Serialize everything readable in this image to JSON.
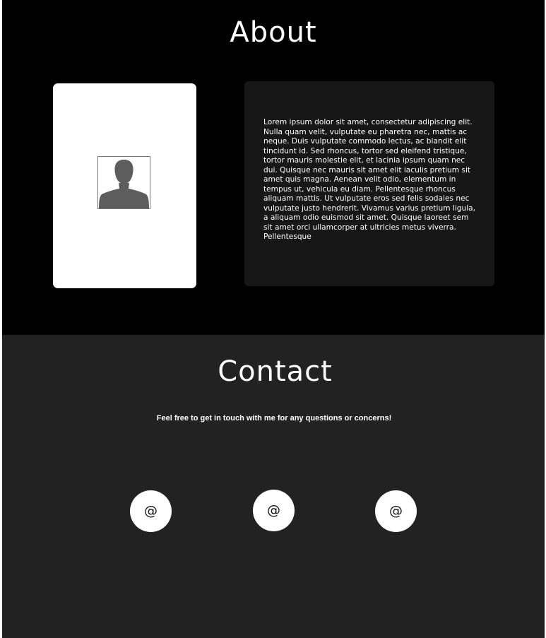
{
  "about": {
    "title": "About",
    "bio": "Lorem ipsum dolor sit amet, consectetur adipiscing elit. Nulla quam velit, vulputate eu pharetra nec, mattis ac neque. Duis vulputate commodo lectus, ac blandit elit tincidunt id. Sed rhoncus, tortor sed eleifend tristique, tortor mauris molestie elit, et lacinia ipsum quam nec dui. Quisque nec mauris sit amet elit iaculis pretium sit amet quis magna. Aenean velit odio, elementum in tempus ut, vehicula eu diam. Pellentesque rhoncus aliquam mattis. Ut vulputate eros sed felis sodales nec vulputate justo hendrerit. Vivamus varius pretium ligula, a aliquam odio euismod sit amet. Quisque laoreet sem sit amet orci ullamcorper at ultricies metus viverra. Pellentesque",
    "avatar_icon": "user-silhouette-icon"
  },
  "contact": {
    "title": "Contact",
    "note": "Feel free to get in touch with me for any questions or concerns!",
    "buttons": [
      {
        "label": "@",
        "icon": "at-sign-icon"
      },
      {
        "label": "@",
        "icon": "at-sign-icon"
      },
      {
        "label": "@",
        "icon": "at-sign-icon"
      }
    ]
  },
  "colors": {
    "about_bg": "#000000",
    "contact_bg": "#222222",
    "bio_card_bg": "#171717",
    "text": "#ffffff"
  }
}
